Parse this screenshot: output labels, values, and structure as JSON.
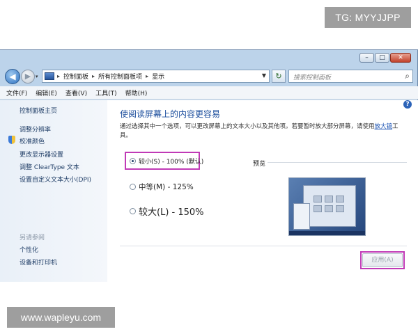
{
  "watermarks": {
    "top": "TG: MYYJJPP",
    "bottom": "www.wapleyu.com"
  },
  "window": {
    "caption_buttons": {
      "minimize": "–",
      "maximize": "□",
      "close": "✕"
    }
  },
  "navigation": {
    "back_glyph": "◀",
    "forward_glyph": "▶",
    "breadcrumb": [
      "控制面板",
      "所有控制面板项",
      "显示"
    ],
    "separator": "▸",
    "refresh_glyph": "↻",
    "search_placeholder": "搜索控制面板"
  },
  "menu": [
    "文件(F)",
    "编辑(E)",
    "查看(V)",
    "工具(T)",
    "帮助(H)"
  ],
  "sidebar": {
    "home": "控制面板主页",
    "links": [
      "调整分辨率",
      "校准颜色",
      "更改显示器设置",
      "调整 ClearType 文本",
      "设置自定义文本大小(DPI)"
    ],
    "see_also_title": "另请参阅",
    "see_also": [
      "个性化",
      "设备和打印机"
    ]
  },
  "main": {
    "heading": "使阅读屏幕上的内容更容易",
    "description_prefix": "通过选择其中一个选项，可以更改屏幕上的文本大小以及其他项。若要暂时放大部分屏幕，请使用",
    "description_link": "放大镜",
    "description_suffix": "工具。",
    "options": [
      {
        "label": "较小(S) - 100% (默认)",
        "selected": true
      },
      {
        "label": "中等(M) - 125%",
        "selected": false
      },
      {
        "label": "较大(L) - 150%",
        "selected": false
      }
    ],
    "preview_label": "预览",
    "apply_label": "应用(A)",
    "help_glyph": "?"
  },
  "colors": {
    "highlight": "#c03ab6",
    "heading": "#1a4c9c",
    "link": "#1a52b3"
  }
}
